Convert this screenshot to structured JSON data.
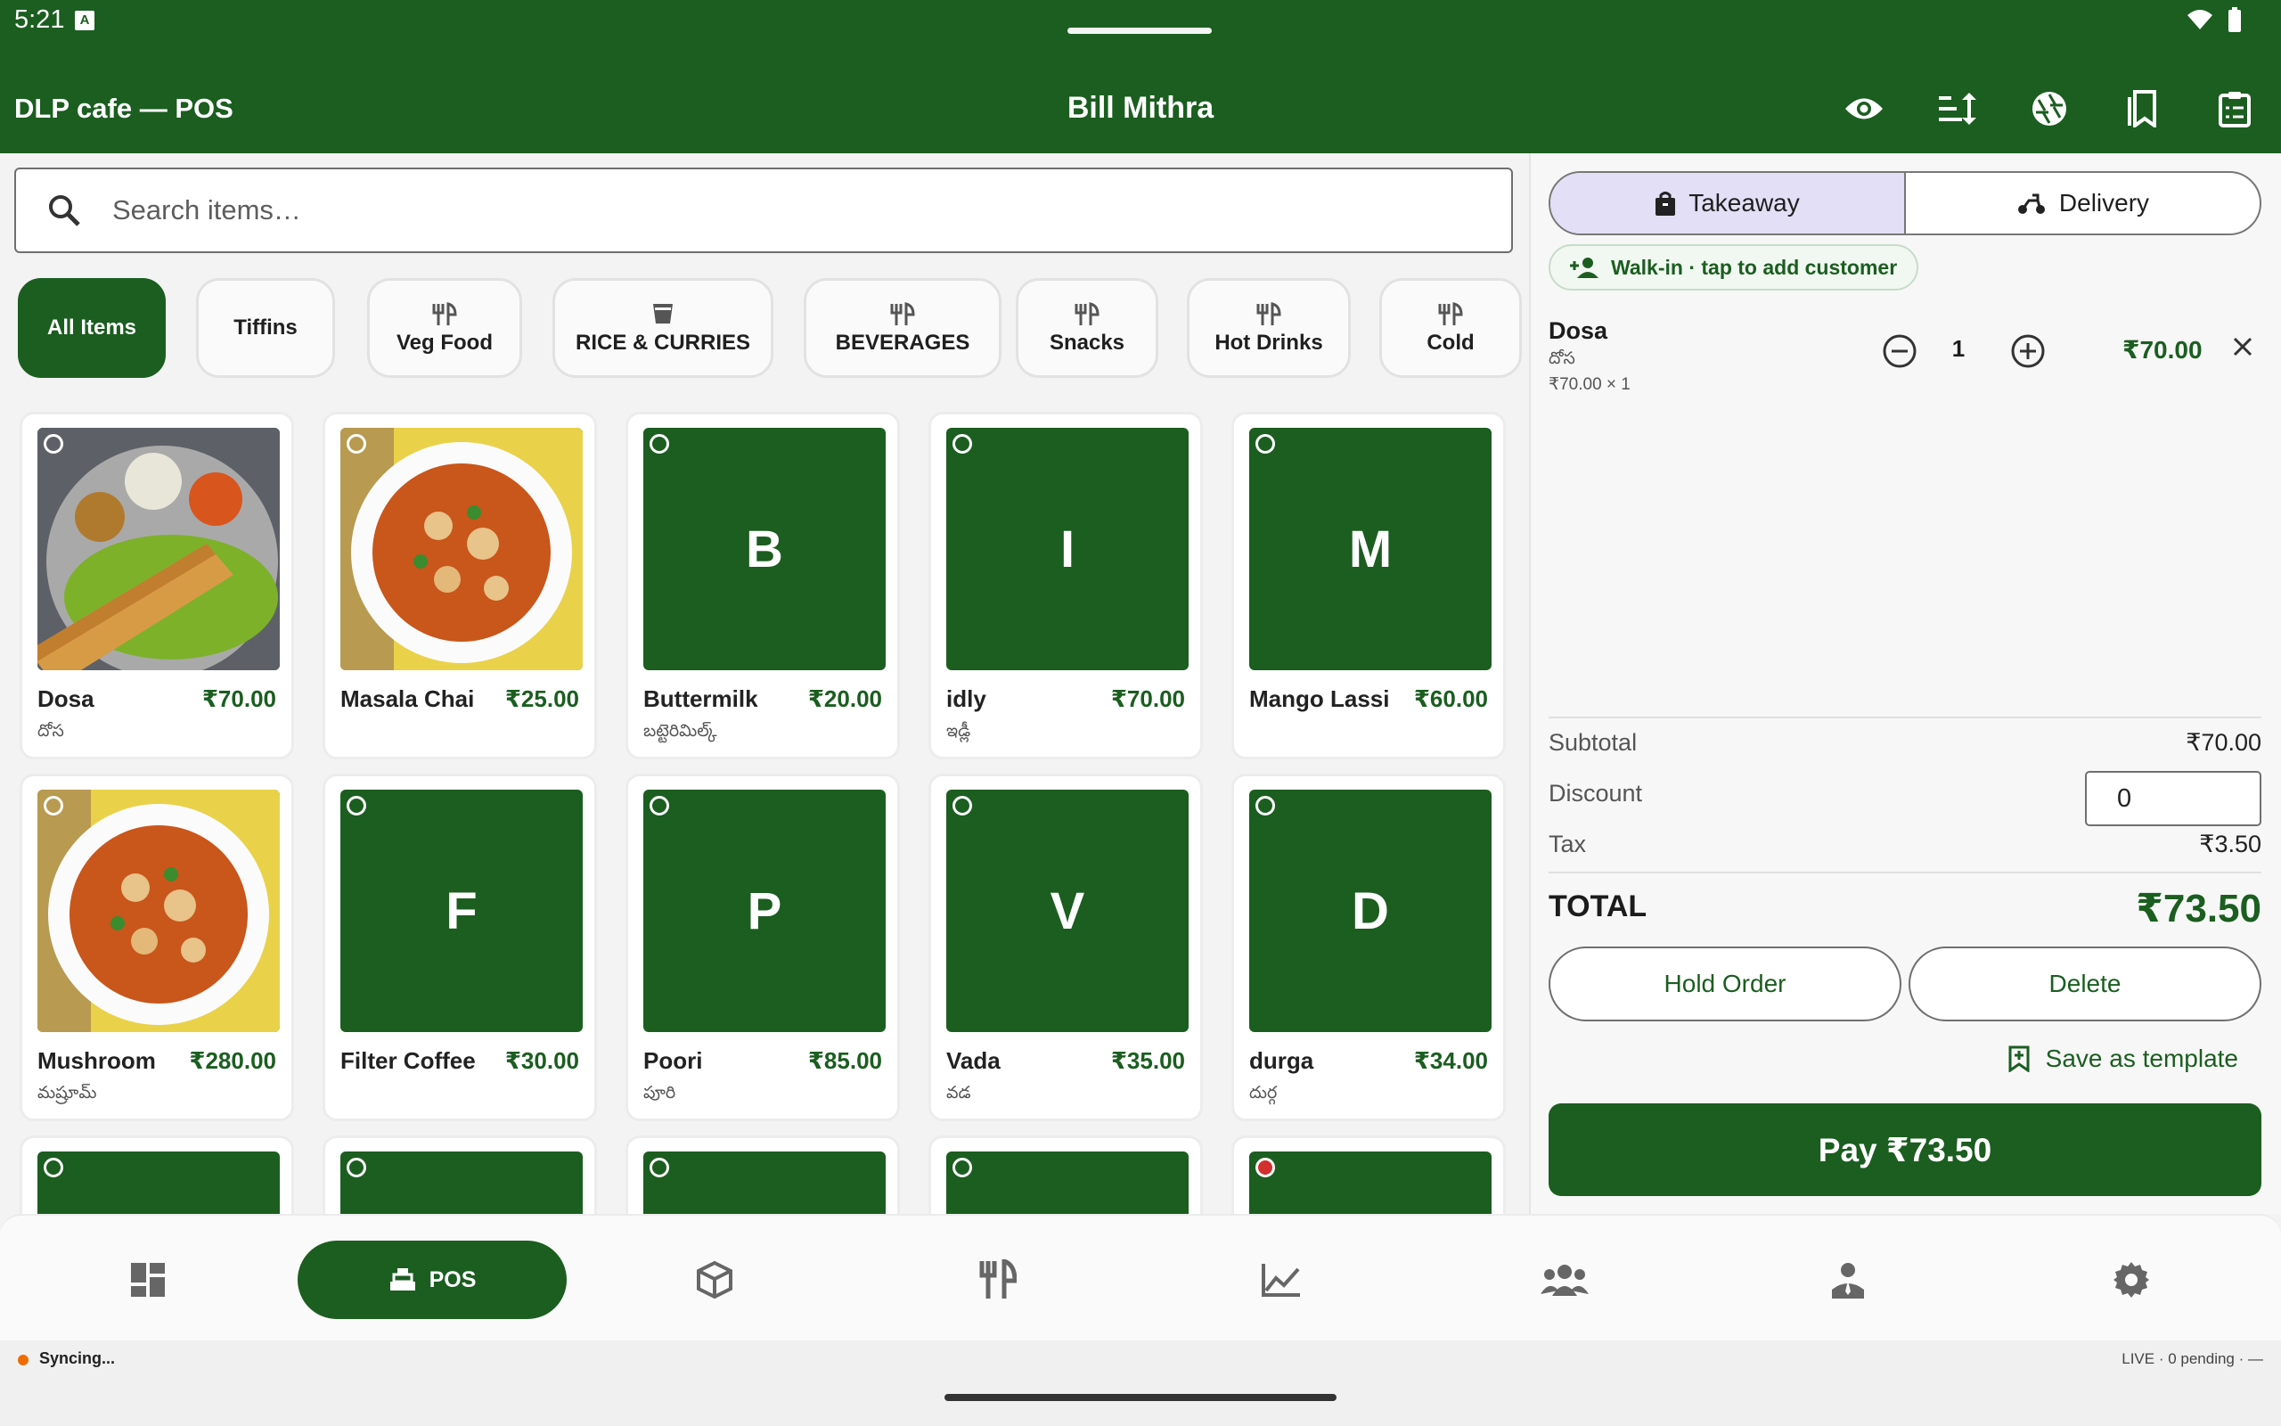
{
  "status": {
    "time": "5:21"
  },
  "appbar": {
    "title": "DLP cafe — POS",
    "center_title": "Bill Mithra"
  },
  "search": {
    "placeholder": "Search items…",
    "value": ""
  },
  "categories": [
    {
      "label": "All Items",
      "icon": "none",
      "active": true
    },
    {
      "label": "Tiffins",
      "icon": "none"
    },
    {
      "label": "Veg Food",
      "icon": "fork-knife-icon"
    },
    {
      "label": "RICE & CURRIES",
      "icon": "cup-icon"
    },
    {
      "label": "BEVERAGES",
      "icon": "fork-knife-icon"
    },
    {
      "label": "Snacks",
      "icon": "fork-knife-icon"
    },
    {
      "label": "Hot Drinks",
      "icon": "fork-knife-icon"
    },
    {
      "label": "Cold",
      "icon": "fork-knife-icon"
    }
  ],
  "items": [
    {
      "name": "Dosa",
      "price": "₹70.00",
      "sub": "దోస",
      "image": "dosa-photo",
      "letter": ""
    },
    {
      "name": "Masala Chai",
      "price": "₹25.00",
      "sub": "",
      "image": "curry-photo",
      "letter": ""
    },
    {
      "name": "Buttermilk",
      "price": "₹20.00",
      "sub": "బట్టెరిమిల్క్",
      "image": "",
      "letter": "B"
    },
    {
      "name": "idly",
      "price": "₹70.00",
      "sub": "ఇడ్లీ",
      "image": "",
      "letter": "I"
    },
    {
      "name": "Mango Lassi",
      "price": "₹60.00",
      "sub": "",
      "image": "",
      "letter": "M"
    },
    {
      "name": "Mushroom",
      "price": "₹280.00",
      "sub": "మష్రూమ్",
      "image": "curry-photo",
      "letter": ""
    },
    {
      "name": "Filter Coffee",
      "price": "₹30.00",
      "sub": "",
      "image": "",
      "letter": "F"
    },
    {
      "name": "Poori",
      "price": "₹85.00",
      "sub": "పూరి",
      "image": "",
      "letter": "P"
    },
    {
      "name": "Vada",
      "price": "₹35.00",
      "sub": "వడ",
      "image": "",
      "letter": "V"
    },
    {
      "name": "durga",
      "price": "₹34.00",
      "sub": "దుర్గ",
      "image": "",
      "letter": "D"
    }
  ],
  "order": {
    "type_options": [
      {
        "label": "Takeaway",
        "icon": "bag-icon",
        "selected": true
      },
      {
        "label": "Delivery",
        "icon": "scooter-icon",
        "selected": false
      }
    ],
    "customer_label": "Walk-in · tap to add customer",
    "lines": [
      {
        "name": "Dosa",
        "sub": "దోస",
        "unit": "₹70.00 × 1",
        "qty": "1",
        "total": "₹70.00"
      }
    ],
    "subtotal_label": "Subtotal",
    "subtotal": "₹70.00",
    "discount_label": "Discount",
    "discount_value": "0",
    "tax_label": "Tax",
    "tax": "₹3.50",
    "total_label": "TOTAL",
    "total": "₹73.50",
    "hold_label": "Hold Order",
    "delete_label": "Delete",
    "save_template_label": "Save as template",
    "pay_label": "Pay ₹73.50"
  },
  "nav": {
    "pos_label": "POS"
  },
  "footer": {
    "sync": "Syncing...",
    "live": "LIVE · 0 pending · —"
  },
  "colors": {
    "primary": "#1b5e20",
    "selected_segment": "#e3dff6",
    "sync_dot": "#ef6c00",
    "veg_dot_red": "#d32f2f"
  }
}
